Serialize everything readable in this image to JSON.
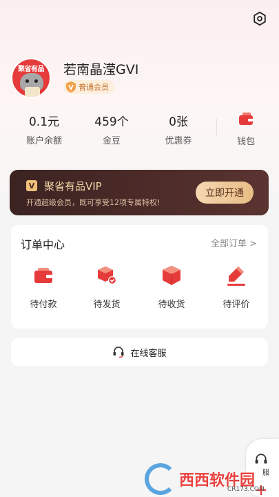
{
  "profile": {
    "username": "若南晶滢GVI",
    "member_level": "普通会员",
    "avatar_brand": "聚省有品"
  },
  "stats": [
    {
      "value": "0.1元",
      "label": "账户余额"
    },
    {
      "value": "459个",
      "label": "金豆"
    },
    {
      "value": "0张",
      "label": "优惠券"
    }
  ],
  "wallet": {
    "label": "钱包"
  },
  "vip": {
    "title": "聚省有品VIP",
    "description": "开通超级会员，既可享受12项专属特权!",
    "button": "立即开通",
    "badge": "V"
  },
  "orders": {
    "title": "订单中心",
    "all_label": "全部订单 >",
    "items": [
      {
        "label": "待付款",
        "icon": "wallet-icon"
      },
      {
        "label": "待发货",
        "icon": "package-check-icon"
      },
      {
        "label": "待收货",
        "icon": "box-icon"
      },
      {
        "label": "待评价",
        "icon": "pen-icon"
      }
    ]
  },
  "service": {
    "label": "在线客服"
  },
  "float": {
    "label": "服"
  },
  "watermark": {
    "text": "西西软件园",
    "sub": "CR173.COM"
  },
  "colors": {
    "accent": "#e63b3b",
    "vip_dark": "#3b2322",
    "vip_gold": "#f3d5a8"
  }
}
